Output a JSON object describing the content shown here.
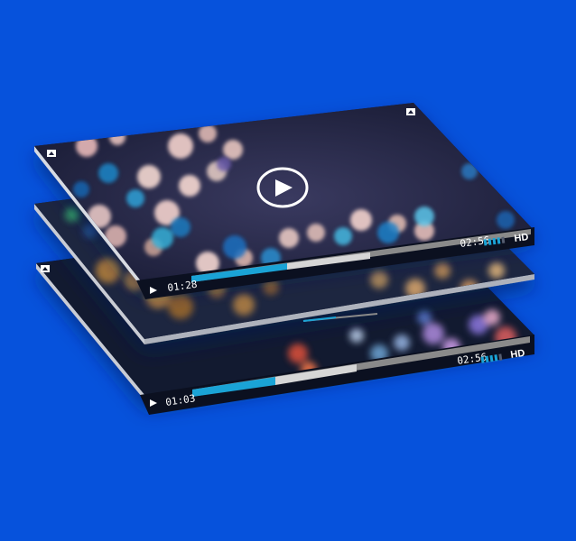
{
  "top_layer": {
    "current_time": "01:28",
    "duration": "02:56",
    "quality_badge": "HD",
    "progress": 0.2,
    "buffered": 0.6,
    "volume_bars_filled": 4,
    "volume_bars_total": 5
  },
  "middle_layer": {
    "loading_progress": 0.5
  },
  "bottom_layer": {
    "current_time": "01:03",
    "duration": "02:56",
    "quality_badge": "HD",
    "progress": 0.32,
    "buffered": 0.6,
    "volume_bars_filled": 4,
    "volume_bars_total": 5
  },
  "colors": {
    "background": "#0652dc",
    "progress": "#1aa3d6",
    "buffer": "#d6d6d6",
    "track": "#8a8a8a",
    "control_bar": "#0b1020"
  }
}
